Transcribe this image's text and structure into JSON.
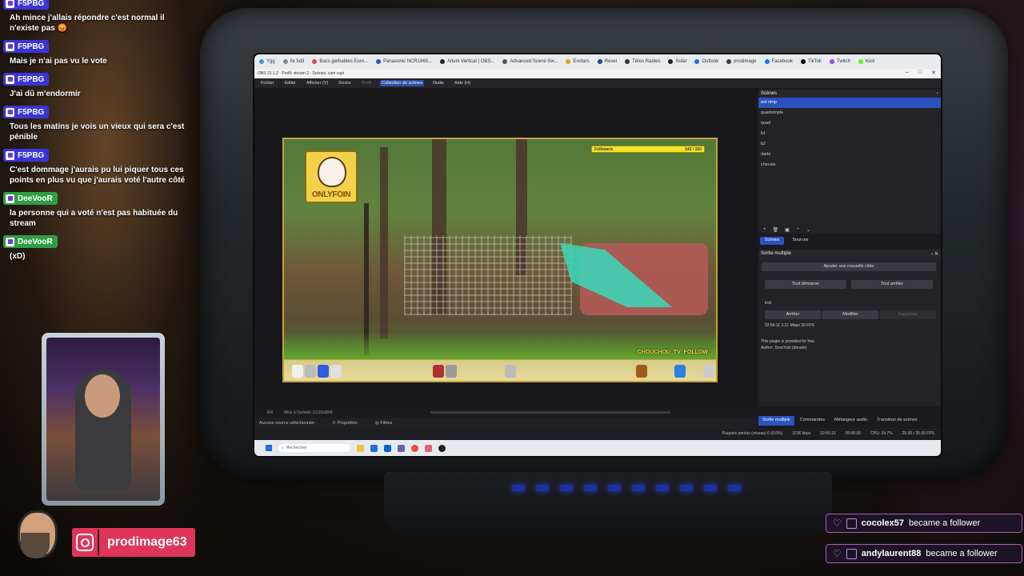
{
  "chat": {
    "messages": [
      {
        "user": "F5PBG",
        "text": "Ah mince j'allais répondre c'est normal il n'existe pas 😡"
      },
      {
        "user": "F5PBG",
        "text": "Mais je n'ai pas vu le vote"
      },
      {
        "user": "F5PBG",
        "text": "J'ai dû m'endormir"
      },
      {
        "user": "F5PBG",
        "text": "Tous les matins je vois un vieux qui sera c'est pénible"
      },
      {
        "user": "F5PBG",
        "text": "C'est dommage j'aurais pu lui piquer tous ces points en plus vu que j'aurais voté l'autre côté"
      },
      {
        "user": "DeeVooR",
        "text": "la personne qui a voté n'est pas habituée du stream"
      },
      {
        "user": "DeeVooR",
        "text": "(xD)"
      }
    ]
  },
  "browser": {
    "bookmarks": [
      "Ygg",
      "fix 5d3",
      "Bacs gerbables Euro...",
      "Panasonic NCR1865...",
      "Aitum Vertical | OBS...",
      "Advanced Scene Sw...",
      "Evotars",
      "Rexel",
      "Têtes Raides",
      "Solar",
      "Outlook",
      "prodimage",
      "Facebook",
      "TikTok",
      "Twitch",
      "Kick"
    ]
  },
  "obs": {
    "window_title": "OBS 31.1.2 - Profil: stream 2 - Scènes: cam capt",
    "menu": [
      "Fichier",
      "Editer",
      "Afficher (V)",
      "Docks",
      "Profil",
      "Collection de scènes",
      "Outils",
      "Aide (H)"
    ],
    "active_menu": "Collection de scènes",
    "preview": {
      "logo_text": "ONLYFOIN",
      "followers_label": "Followers",
      "followers_count": "142 / 150",
      "follow_tag": "CHOUCHOU_TV_FOLLOW"
    },
    "preview_footer": [
      "EN",
      "Mise à l'échelle (1216x684)"
    ],
    "no_source": "Aucune source sélectionnée",
    "properties": "Propriétés",
    "filters": "Filtres",
    "scenes": {
      "title": "Scènes",
      "items": [
        "ext rtmp",
        "quadsimple",
        "quad",
        "b1",
        "b2",
        "dada",
        "chevals"
      ],
      "selected": "ext rtmp"
    },
    "tabs": [
      "Scènes",
      "Sources"
    ],
    "multi_output": {
      "title": "Sortie multiple",
      "add_target": "Ajouter une nouvelle cible",
      "start_all": "Tout démarrer",
      "stop_all": "Tout arrêter",
      "target_name": "kick",
      "stop": "Arrêter",
      "edit": "Modifier",
      "delete": "Supprimer",
      "stats": "02:56:11  3.21 Mbps  25 FPS",
      "note": "This plugin is provided for free.",
      "author": "Author: SoraYuki (donate)"
    },
    "dock_tabs": [
      "Sortie multiple",
      "Commandes",
      "Mélangeur audio",
      "Transition de scènes"
    ],
    "status": [
      "Paquets perdus (réseau) 0 (0.0%)",
      "3236 kbps",
      "02:56:16",
      "00:00:00",
      "CPU: 24.7%",
      "25.00 / 25.00 FPS"
    ]
  },
  "taskbar": {
    "search_placeholder": "Rechercher"
  },
  "instagram": {
    "handle": "prodimage63"
  },
  "alerts": [
    {
      "user": "cocolex57",
      "text": "became a follower"
    },
    {
      "user": "andylaurent88",
      "text": "became a follower"
    }
  ]
}
